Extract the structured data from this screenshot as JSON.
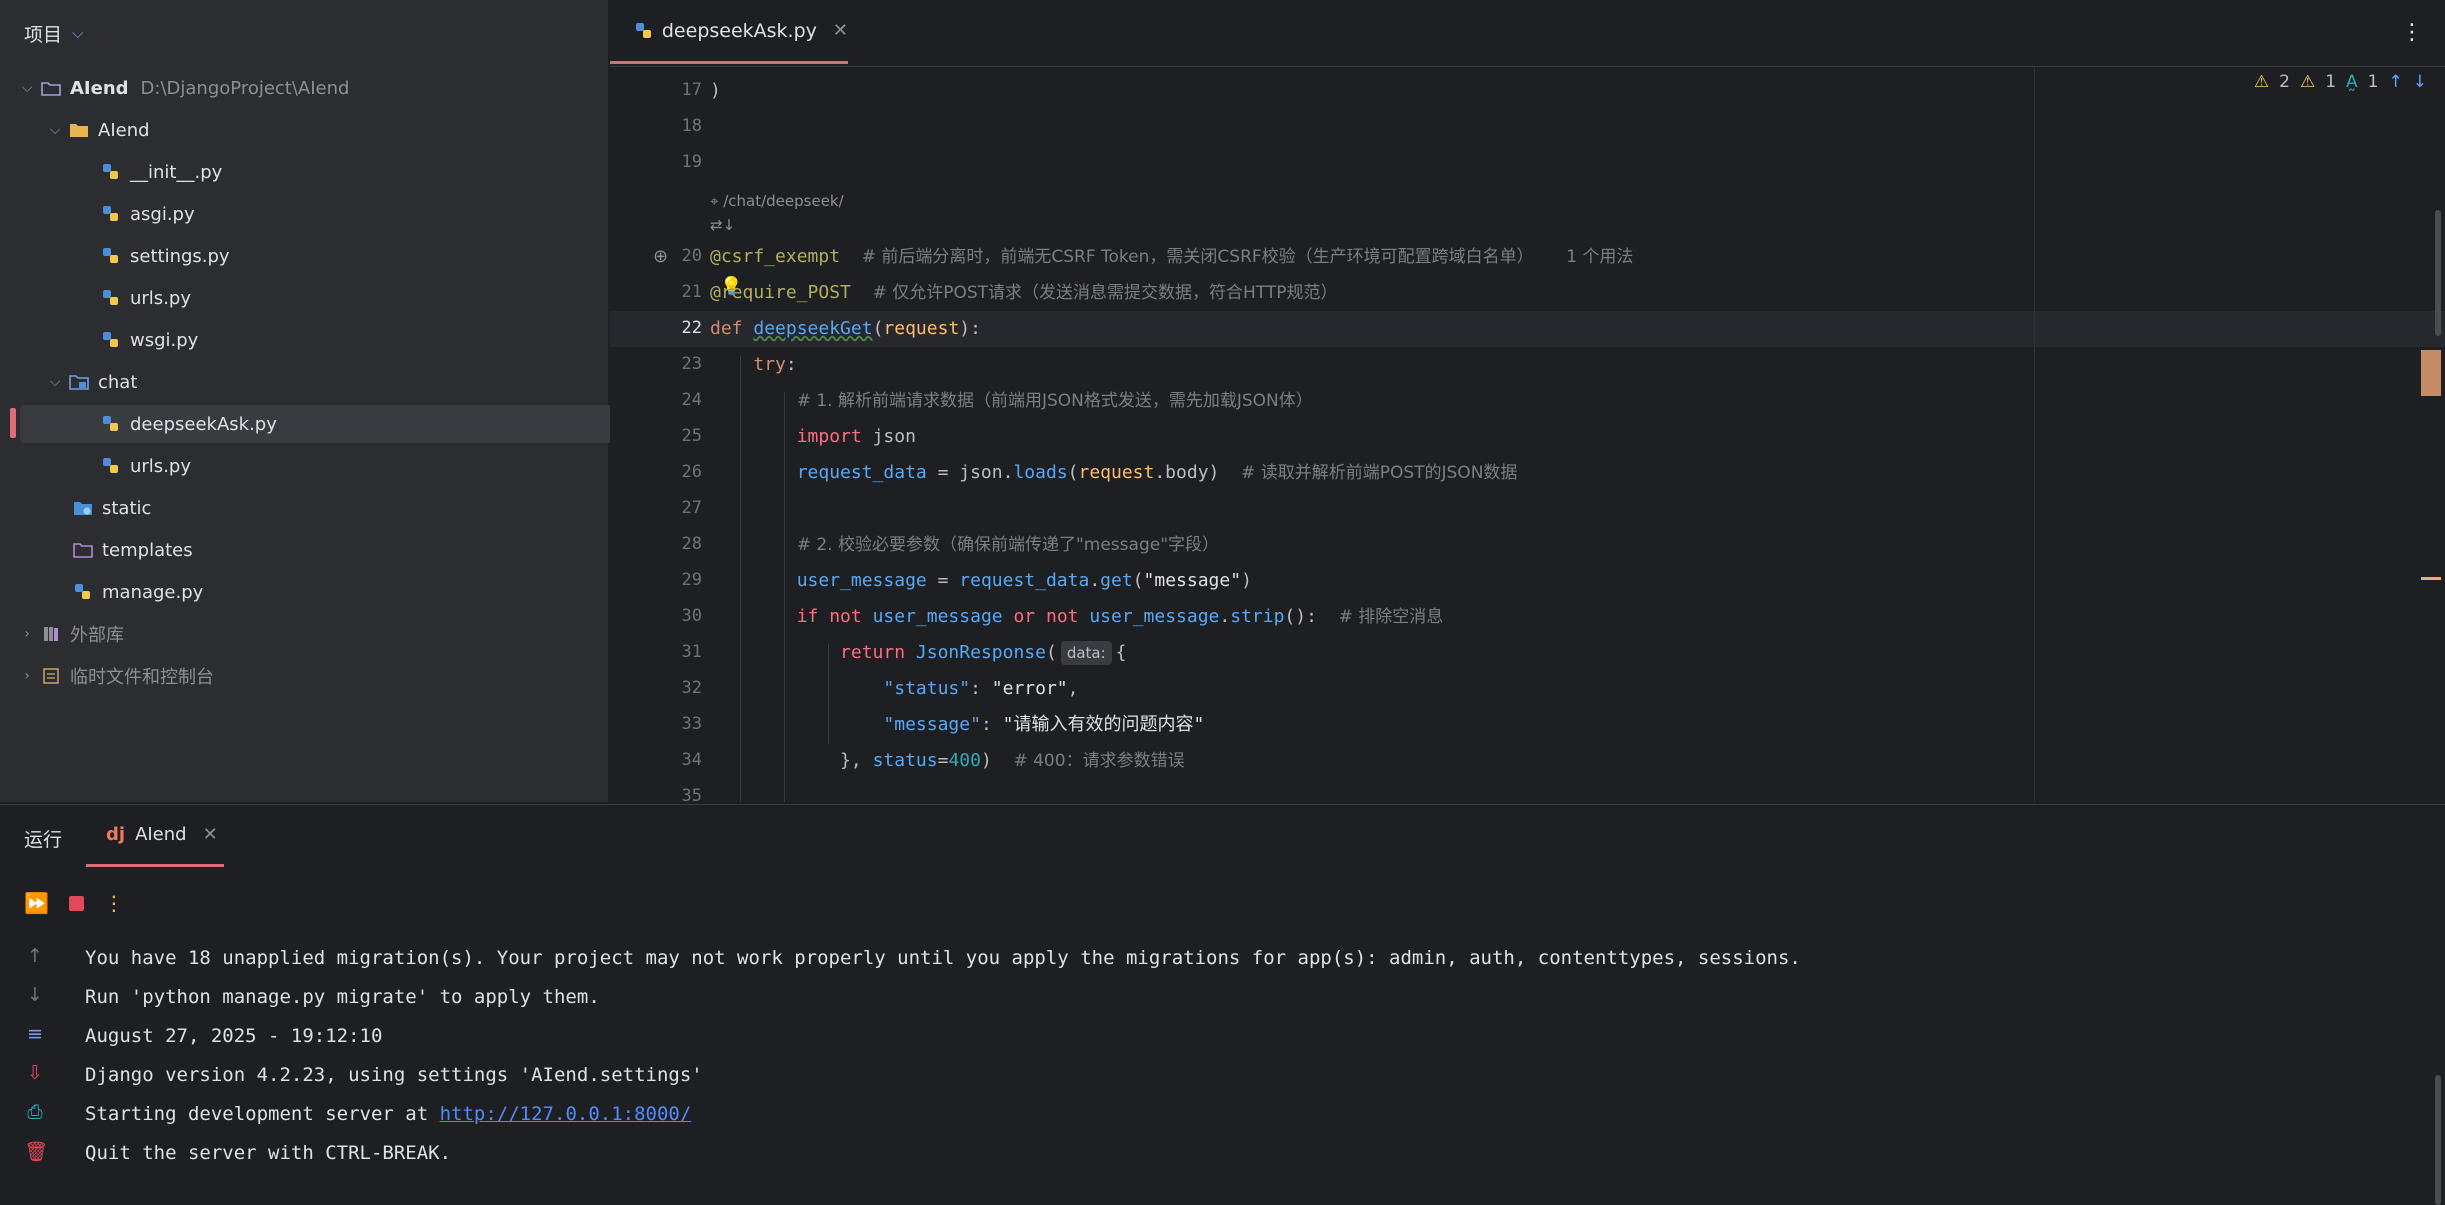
{
  "project_panel": {
    "title": "项目",
    "items": [
      {
        "label": "AIend",
        "path": "D:\\DjangoProject\\AIend",
        "type": "root"
      },
      {
        "label": "AIend",
        "type": "folder"
      },
      {
        "label": "__init__.py",
        "type": "py"
      },
      {
        "label": "asgi.py",
        "type": "py"
      },
      {
        "label": "settings.py",
        "type": "py"
      },
      {
        "label": "urls.py",
        "type": "py"
      },
      {
        "label": "wsgi.py",
        "type": "py"
      },
      {
        "label": "chat",
        "type": "module"
      },
      {
        "label": "deepseekAsk.py",
        "type": "py",
        "selected": true
      },
      {
        "label": "urls.py",
        "type": "py"
      },
      {
        "label": "static",
        "type": "static"
      },
      {
        "label": "templates",
        "type": "folder-outline"
      },
      {
        "label": "manage.py",
        "type": "py"
      },
      {
        "label": "外部库",
        "type": "lib"
      },
      {
        "label": "临时文件和控制台",
        "type": "scratch"
      }
    ]
  },
  "editor": {
    "tab_label": "deepseekAsk.py",
    "inspections": {
      "warnings": "2",
      "weak_warnings": "1",
      "typos": "1"
    },
    "route_hint": "/chat/deepseek/",
    "line_numbers": [
      "17",
      "18",
      "19",
      "20",
      "21",
      "22",
      "23",
      "24",
      "25",
      "26",
      "27",
      "28",
      "29",
      "30",
      "31",
      "32",
      "33",
      "34",
      "35"
    ],
    "current_line": "22",
    "usage_hint": "1 个用法",
    "param_hint": "data:",
    "comments": {
      "l20": "# 前后端分离时，前端无CSRF Token，需关闭CSRF校验（生产环境可配置跨域白名单）",
      "l21": "# 仅允许POST请求（发送消息需提交数据，符合HTTP规范）",
      "l24": "# 1. 解析前端请求数据（前端用JSON格式发送，需先加载JSON体）",
      "l26": "# 读取并解析前端POST的JSON数据",
      "l28": "# 2. 校验必要参数（确保前端传递了\"message\"字段）",
      "l30": "# 排除空消息",
      "l34": "# 400：请求参数错误"
    },
    "strings": {
      "message_key": "\"message\"",
      "status_key": "\"status\"",
      "error_val": "\"error\"",
      "message_val": "\"请输入有效的问题内容\""
    }
  },
  "run_panel": {
    "title": "运行",
    "tab_label": "AIend",
    "console_lines": [
      "You have 18 unapplied migration(s). Your project may not work properly until you apply the migrations for app(s): admin, auth, contenttypes, sessions.",
      "Run 'python manage.py migrate' to apply them.",
      "August 27, 2025 - 19:12:10",
      "Django version 4.2.23, using settings 'AIend.settings'",
      "Starting development server at ",
      "Quit the server with CTRL-BREAK."
    ],
    "server_url": "http://127.0.0.1:8000/"
  },
  "colors": {
    "accent": "#e06c75",
    "background": "#1e1f22",
    "panel": "#2b2d30",
    "link": "#548af7"
  }
}
